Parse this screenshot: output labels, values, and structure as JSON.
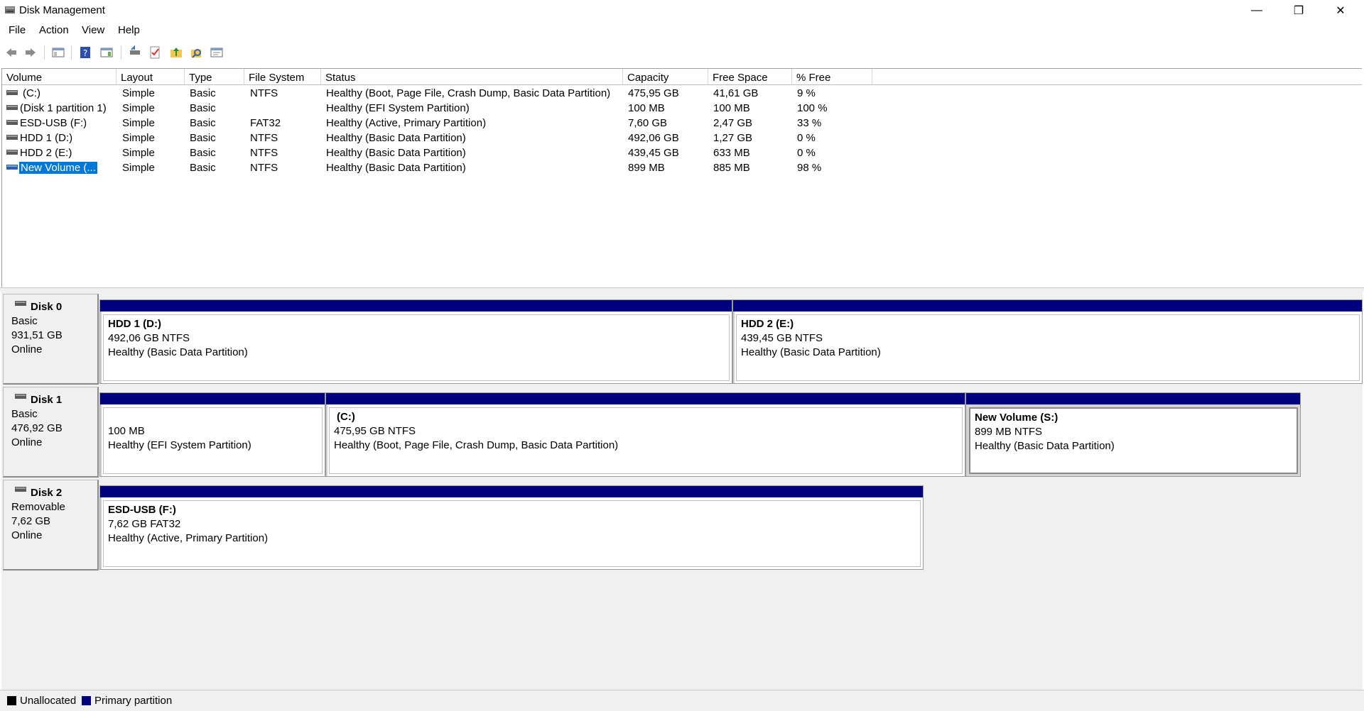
{
  "window": {
    "title": "Disk Management",
    "controls": {
      "minimize": "—",
      "maximize": "❐",
      "close": "✕"
    }
  },
  "menu": [
    "File",
    "Action",
    "View",
    "Help"
  ],
  "toolbar": [
    "back-icon",
    "forward-icon",
    "console-tree-icon",
    "help-icon",
    "show-hide-icon",
    "connect-disk-icon",
    "check-icon",
    "up-folder-icon",
    "search-icon",
    "properties-icon"
  ],
  "columns": [
    "Volume",
    "Layout",
    "Type",
    "File System",
    "Status",
    "Capacity",
    "Free Space",
    "% Free"
  ],
  "volumes": [
    {
      "volume": "(C:)",
      "layout": "Simple",
      "type": "Basic",
      "fs": "NTFS",
      "status": "Healthy (Boot, Page File, Crash Dump, Basic Data Partition)",
      "capacity": "475,95 GB",
      "free": "41,61 GB",
      "pct": "9 %"
    },
    {
      "volume": "(Disk 1 partition 1)",
      "layout": "Simple",
      "type": "Basic",
      "fs": "",
      "status": "Healthy (EFI System Partition)",
      "capacity": "100 MB",
      "free": "100 MB",
      "pct": "100 %"
    },
    {
      "volume": "ESD-USB (F:)",
      "layout": "Simple",
      "type": "Basic",
      "fs": "FAT32",
      "status": "Healthy (Active, Primary Partition)",
      "capacity": "7,60 GB",
      "free": "2,47 GB",
      "pct": "33 %"
    },
    {
      "volume": "HDD 1 (D:)",
      "layout": "Simple",
      "type": "Basic",
      "fs": "NTFS",
      "status": "Healthy (Basic Data Partition)",
      "capacity": "492,06 GB",
      "free": "1,27 GB",
      "pct": "0 %"
    },
    {
      "volume": "HDD 2 (E:)",
      "layout": "Simple",
      "type": "Basic",
      "fs": "NTFS",
      "status": "Healthy (Basic Data Partition)",
      "capacity": "439,45 GB",
      "free": "633 MB",
      "pct": "0 %"
    },
    {
      "volume": "New Volume (...",
      "layout": "Simple",
      "type": "Basic",
      "fs": "NTFS",
      "status": "Healthy (Basic Data Partition)",
      "capacity": "899 MB",
      "free": "885 MB",
      "pct": "98 %"
    }
  ],
  "disks": [
    {
      "name": "Disk 0",
      "kind": "Basic",
      "size": "931,51 GB",
      "state": "Online",
      "partitions": [
        {
          "title": "HDD 1  (D:)",
          "line1": "492,06 GB NTFS",
          "line2": "Healthy (Basic Data Partition)"
        },
        {
          "title": "HDD 2  (E:)",
          "line1": "439,45 GB NTFS",
          "line2": "Healthy (Basic Data Partition)"
        }
      ]
    },
    {
      "name": "Disk 1",
      "kind": "Basic",
      "size": "476,92 GB",
      "state": "Online",
      "partitions": [
        {
          "title": "",
          "line1": "100 MB",
          "line2": "Healthy (EFI System Partition)"
        },
        {
          "title": "(C:)",
          "line1": "475,95 GB NTFS",
          "line2": "Healthy (Boot, Page File, Crash Dump, Basic Data Partition)"
        },
        {
          "title": "New Volume  (S:)",
          "line1": "899 MB NTFS",
          "line2": "Healthy (Basic Data Partition)"
        }
      ]
    },
    {
      "name": "Disk 2",
      "kind": "Removable",
      "size": "7,62 GB",
      "state": "Online",
      "partitions": [
        {
          "title": "ESD-USB  (F:)",
          "line1": "7,62 GB FAT32",
          "line2": "Healthy (Active, Primary Partition)"
        }
      ]
    }
  ],
  "legend": [
    {
      "label": "Unallocated",
      "color": "#000000"
    },
    {
      "label": "Primary partition",
      "color": "#00007f"
    }
  ]
}
